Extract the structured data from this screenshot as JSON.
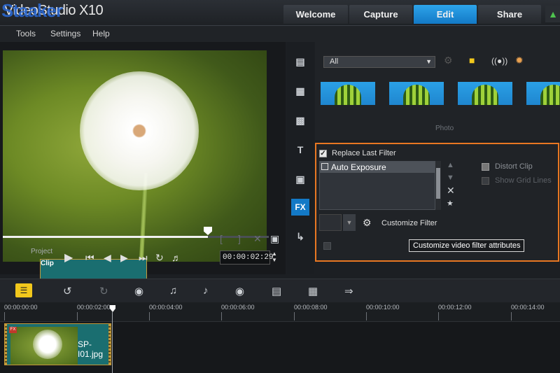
{
  "window": {
    "title": "VideoStudio X10",
    "watermark": "Staaker"
  },
  "tabs": [
    {
      "label": "Welcome",
      "active": false
    },
    {
      "label": "Capture",
      "active": false
    },
    {
      "label": "Edit",
      "active": true
    },
    {
      "label": "Share",
      "active": false
    }
  ],
  "menu": [
    "Tools",
    "Settings",
    "Help"
  ],
  "preview": {
    "mode_project": "Project",
    "mode_clip": "Clip",
    "timecode": "00:00:02:29",
    "playhead_fraction": 0.77
  },
  "library": {
    "filter_select": "All",
    "caption": "Photo",
    "thumb_count": 4
  },
  "options": {
    "replace_last_filter": "Replace Last Filter",
    "replace_checked": true,
    "filter_items": [
      "Auto Exposure"
    ],
    "distort_clip": "Distort Clip",
    "show_grid_lines": "Show Grid Lines",
    "customize_filter": "Customize Filter",
    "tooltip": "Customize video filter attributes"
  },
  "timeline": {
    "ruler_labels": [
      "00:00:00:00",
      "00:00:02:00",
      "00:00:04:00",
      "00:00:06:00",
      "00:00:08:00",
      "00:00:10:00",
      "00:00:12:00",
      "00:00:14:00"
    ],
    "clip_name": "SP-I01.jpg",
    "clip_badge": "FX"
  },
  "colors": {
    "accent": "#1379c6",
    "highlight_border": "#e87722",
    "home_icon": "#4fc34f"
  },
  "icons": {
    "home": "home-icon",
    "storyboard": "storyboard-view-icon",
    "undo": "undo-icon",
    "redo": "redo-icon",
    "fx_side": "fx-icon"
  }
}
